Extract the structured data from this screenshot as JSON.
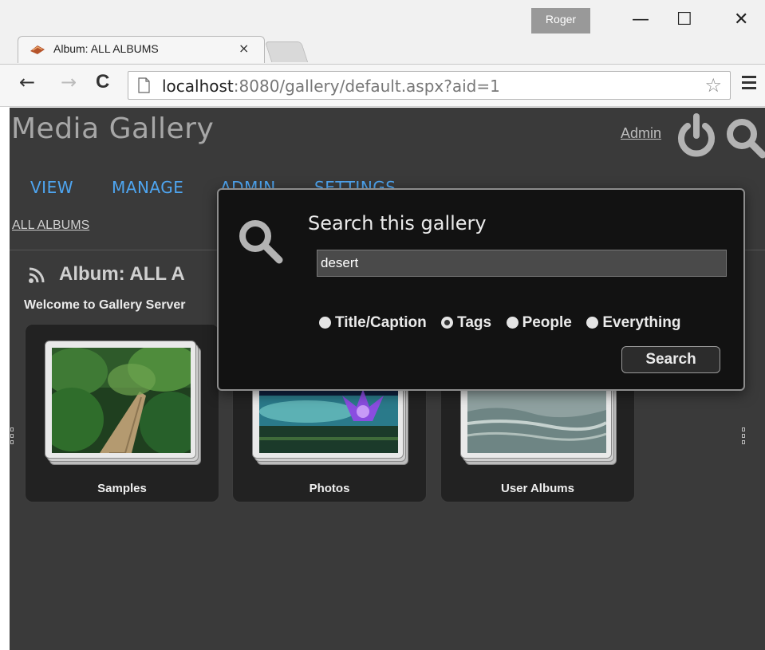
{
  "browser": {
    "user_badge": "Roger",
    "window_controls": {
      "minimize": "—",
      "maximize": "☐",
      "close": "✕"
    },
    "tab": {
      "title": "Album: ALL ALBUMS",
      "close": "×",
      "favicon": "gallery-favicon-icon"
    },
    "nav": {
      "back": "←",
      "forward": "→",
      "reload": "C"
    },
    "url": {
      "host": "localhost",
      "rest": ":8080/gallery/default.aspx?aid=1"
    },
    "bookmark": "☆"
  },
  "site": {
    "title": "Media Gallery",
    "admin_link": "Admin",
    "icons": [
      "power-icon",
      "search-icon"
    ]
  },
  "nav": {
    "items": [
      "VIEW",
      "MANAGE",
      "ADMIN",
      "SETTINGS"
    ]
  },
  "breadcrumb": "ALL ALBUMS",
  "album": {
    "title": "Album: ALL A",
    "welcome": "Welcome to Gallery Server",
    "cards": [
      {
        "label": "Samples"
      },
      {
        "label": "Photos"
      },
      {
        "label": "User Albums"
      }
    ]
  },
  "search_popup": {
    "title": "Search this gallery",
    "query": "desert",
    "options": [
      "Title/Caption",
      "Tags",
      "People",
      "Everything"
    ],
    "selected": "Tags",
    "button": "Search"
  },
  "colors": {
    "nav_link": "#4ea5f0",
    "page_bg": "#3a3a3a",
    "popup_bg": "#121212"
  }
}
